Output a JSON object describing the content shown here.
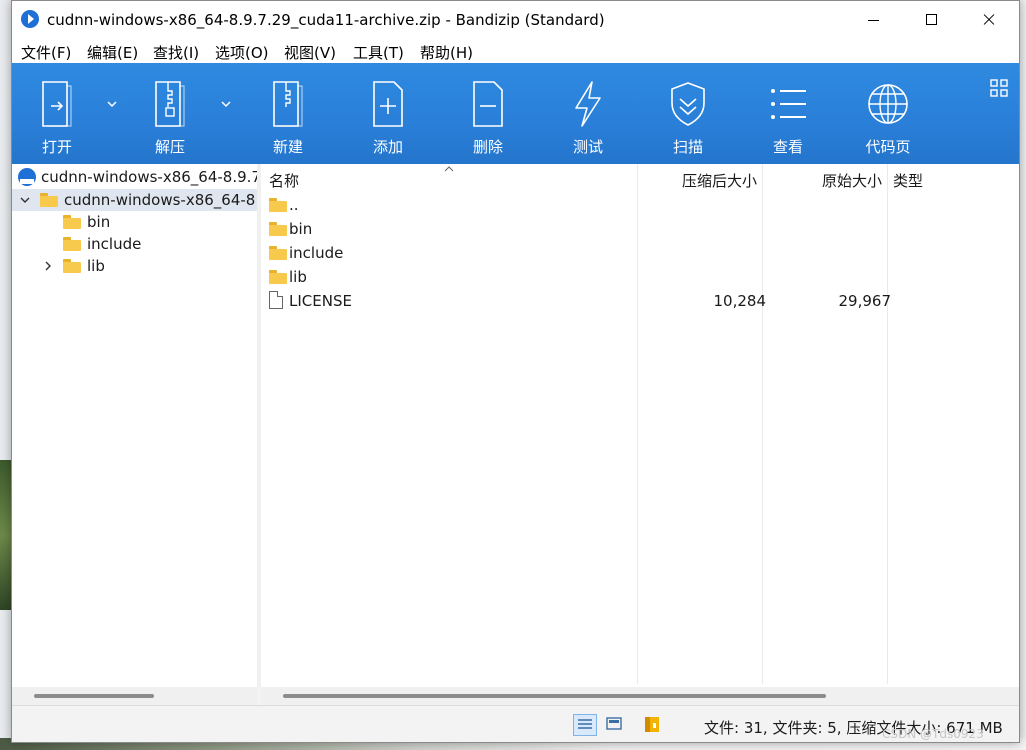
{
  "window": {
    "title": "cudnn-windows-x86_64-8.9.7.29_cuda11-archive.zip - Bandizip (Standard)"
  },
  "menu": [
    "文件(F)",
    "编辑(E)",
    "查找(I)",
    "选项(O)",
    "视图(V)",
    "工具(T)",
    "帮助(H)"
  ],
  "toolbar": {
    "open": "打开",
    "extract": "解压",
    "new": "新建",
    "add": "添加",
    "delete": "删除",
    "test": "测试",
    "scan": "扫描",
    "view": "查看",
    "codepage": "代码页"
  },
  "tree": {
    "archive": "cudnn-windows-x86_64-8.9.7",
    "root_folder": "cudnn-windows-x86_64-8.",
    "children": [
      "bin",
      "include",
      "lib"
    ]
  },
  "filelist": {
    "columns": {
      "name": "名称",
      "compressed": "压缩后大小",
      "original": "原始大小",
      "type": "类型"
    },
    "rows": [
      {
        "name": "..",
        "kind": "folder",
        "compressed": "",
        "original": ""
      },
      {
        "name": "bin",
        "kind": "folder",
        "compressed": "",
        "original": ""
      },
      {
        "name": "include",
        "kind": "folder",
        "compressed": "",
        "original": ""
      },
      {
        "name": "lib",
        "kind": "folder",
        "compressed": "",
        "original": ""
      },
      {
        "name": "LICENSE",
        "kind": "file",
        "compressed": "10,284",
        "original": "29,967"
      }
    ]
  },
  "status": {
    "summary": "文件: 31, 文件夹: 5, 压缩文件大小: 671 MB"
  },
  "watermark": "CSDN @Tds0923",
  "colors": {
    "toolbar": "#2a7fd8",
    "folder": "#f7c94c",
    "selection": "#dfe6f0"
  }
}
